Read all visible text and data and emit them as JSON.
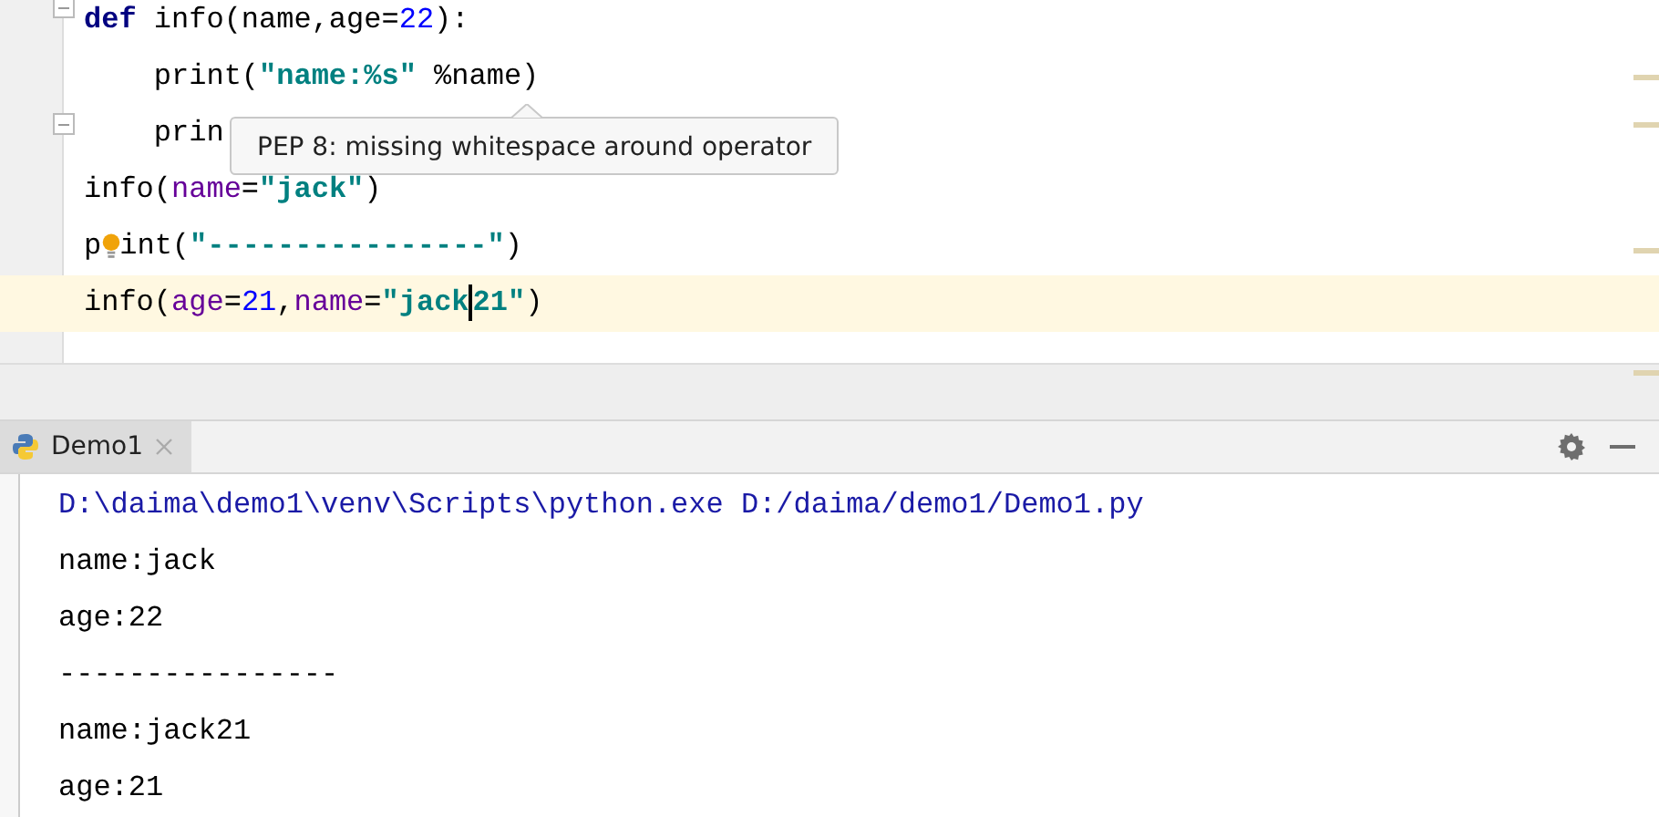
{
  "editor": {
    "lines": [
      {
        "fold_marker": true,
        "current": false,
        "tokens": [
          {
            "kind": "keyword",
            "text": "def"
          },
          {
            "kind": "plain",
            "text": " info(name,age="
          },
          {
            "kind": "number",
            "text": "22"
          },
          {
            "kind": "plain",
            "text": "):"
          }
        ]
      },
      {
        "fold_marker": false,
        "current": false,
        "tokens": [
          {
            "kind": "plain",
            "text": "    print("
          },
          {
            "kind": "string",
            "text": "\"name:%s\""
          },
          {
            "kind": "plain",
            "text": " %name)"
          }
        ]
      },
      {
        "fold_marker": true,
        "current": false,
        "tokens": [
          {
            "kind": "plain",
            "text": "    prin"
          }
        ]
      },
      {
        "fold_marker": false,
        "current": false,
        "tokens": [
          {
            "kind": "plain",
            "text": "info("
          },
          {
            "kind": "param",
            "text": "name"
          },
          {
            "kind": "plain",
            "text": "="
          },
          {
            "kind": "string",
            "text": "\"jack\""
          },
          {
            "kind": "plain",
            "text": ")"
          }
        ]
      },
      {
        "fold_marker": false,
        "current": false,
        "tokens": [
          {
            "kind": "plain",
            "text": "p"
          },
          {
            "kind": "bulb"
          },
          {
            "kind": "plain",
            "text": "int("
          },
          {
            "kind": "string",
            "text": "\"----------------\""
          },
          {
            "kind": "plain",
            "text": ")"
          }
        ]
      },
      {
        "fold_marker": false,
        "current": true,
        "tokens": [
          {
            "kind": "plain",
            "text": "info("
          },
          {
            "kind": "param",
            "text": "age"
          },
          {
            "kind": "plain",
            "text": "="
          },
          {
            "kind": "number",
            "text": "21"
          },
          {
            "kind": "plain",
            "text": ","
          },
          {
            "kind": "param",
            "text": "name"
          },
          {
            "kind": "plain",
            "text": "="
          },
          {
            "kind": "string",
            "text": "\"jack"
          },
          {
            "kind": "caret"
          },
          {
            "kind": "string",
            "text": "21\""
          },
          {
            "kind": "plain",
            "text": ")"
          }
        ]
      }
    ],
    "tooltip": "PEP 8: missing whitespace around operator"
  },
  "run_panel": {
    "tabs": [
      {
        "label": "Demo1",
        "selected": true
      }
    ],
    "output": [
      {
        "kind": "command",
        "text": "D:\\daima\\demo1\\venv\\Scripts\\python.exe D:/daima/demo1/Demo1.py"
      },
      {
        "kind": "output",
        "text": "name:jack"
      },
      {
        "kind": "output",
        "text": "age:22"
      },
      {
        "kind": "output",
        "text": "----------------"
      },
      {
        "kind": "output",
        "text": "name:jack21"
      },
      {
        "kind": "output",
        "text": "age:21"
      }
    ]
  }
}
